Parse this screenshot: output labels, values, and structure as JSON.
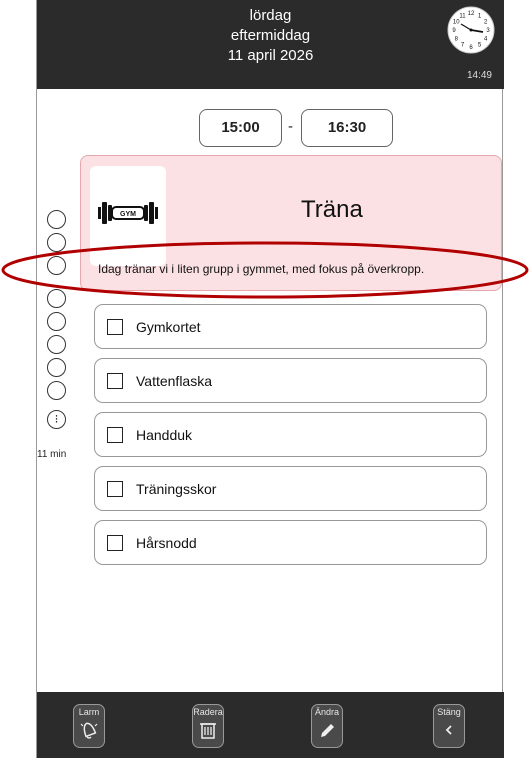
{
  "header": {
    "day": "lördag",
    "part_of_day": "eftermiddag",
    "date": "11 april 2026",
    "clock_time": "14:49",
    "clock_numbers": [
      "12",
      "1",
      "2",
      "3",
      "4",
      "5",
      "6",
      "7",
      "8",
      "9",
      "10",
      "11"
    ]
  },
  "schedule": {
    "start_time": "15:00",
    "separator": "-",
    "end_time": "16:30"
  },
  "activity": {
    "icon_text": "GYM",
    "title": "Träna",
    "description": "Idag tränar vi i liten grupp i gymmet, med fokus på överkropp.",
    "color": "#fbe1e3"
  },
  "progress": {
    "remaining": "11 min",
    "steps": 8
  },
  "checklist": [
    {
      "label": "Gymkortet",
      "checked": false
    },
    {
      "label": "Vattenflaska",
      "checked": false
    },
    {
      "label": "Handduk",
      "checked": false
    },
    {
      "label": "Träningsskor",
      "checked": false
    },
    {
      "label": "Hårsnodd",
      "checked": false
    }
  ],
  "footer": {
    "alarm_label": "Larm",
    "delete_label": "Radera",
    "edit_label": "Ändra",
    "close_label": "Stäng"
  },
  "annotation_color": "#b00000"
}
